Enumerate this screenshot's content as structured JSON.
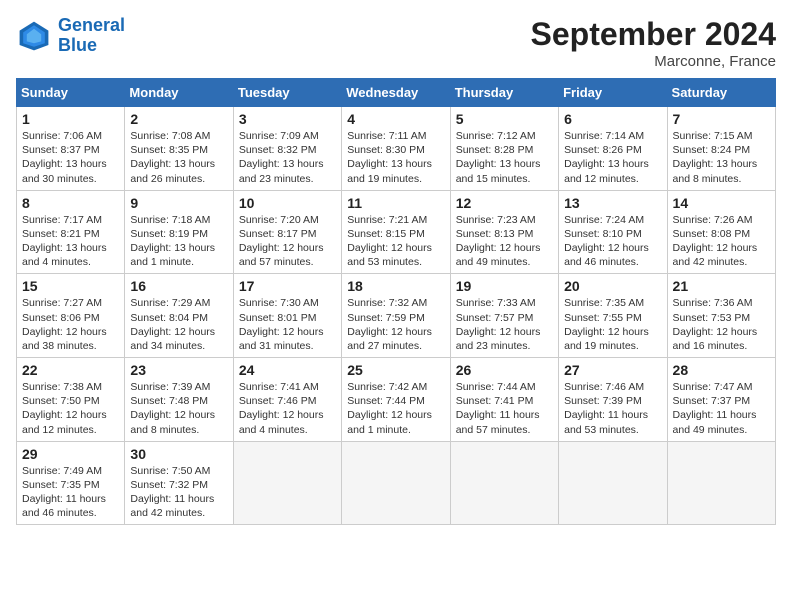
{
  "header": {
    "logo_line1": "General",
    "logo_line2": "Blue",
    "month_title": "September 2024",
    "location": "Marconne, France"
  },
  "days_of_week": [
    "Sunday",
    "Monday",
    "Tuesday",
    "Wednesday",
    "Thursday",
    "Friday",
    "Saturday"
  ],
  "weeks": [
    [
      {
        "day": "1",
        "info": "Sunrise: 7:06 AM\nSunset: 8:37 PM\nDaylight: 13 hours\nand 30 minutes."
      },
      {
        "day": "2",
        "info": "Sunrise: 7:08 AM\nSunset: 8:35 PM\nDaylight: 13 hours\nand 26 minutes."
      },
      {
        "day": "3",
        "info": "Sunrise: 7:09 AM\nSunset: 8:32 PM\nDaylight: 13 hours\nand 23 minutes."
      },
      {
        "day": "4",
        "info": "Sunrise: 7:11 AM\nSunset: 8:30 PM\nDaylight: 13 hours\nand 19 minutes."
      },
      {
        "day": "5",
        "info": "Sunrise: 7:12 AM\nSunset: 8:28 PM\nDaylight: 13 hours\nand 15 minutes."
      },
      {
        "day": "6",
        "info": "Sunrise: 7:14 AM\nSunset: 8:26 PM\nDaylight: 13 hours\nand 12 minutes."
      },
      {
        "day": "7",
        "info": "Sunrise: 7:15 AM\nSunset: 8:24 PM\nDaylight: 13 hours\nand 8 minutes."
      }
    ],
    [
      {
        "day": "8",
        "info": "Sunrise: 7:17 AM\nSunset: 8:21 PM\nDaylight: 13 hours\nand 4 minutes."
      },
      {
        "day": "9",
        "info": "Sunrise: 7:18 AM\nSunset: 8:19 PM\nDaylight: 13 hours\nand 1 minute."
      },
      {
        "day": "10",
        "info": "Sunrise: 7:20 AM\nSunset: 8:17 PM\nDaylight: 12 hours\nand 57 minutes."
      },
      {
        "day": "11",
        "info": "Sunrise: 7:21 AM\nSunset: 8:15 PM\nDaylight: 12 hours\nand 53 minutes."
      },
      {
        "day": "12",
        "info": "Sunrise: 7:23 AM\nSunset: 8:13 PM\nDaylight: 12 hours\nand 49 minutes."
      },
      {
        "day": "13",
        "info": "Sunrise: 7:24 AM\nSunset: 8:10 PM\nDaylight: 12 hours\nand 46 minutes."
      },
      {
        "day": "14",
        "info": "Sunrise: 7:26 AM\nSunset: 8:08 PM\nDaylight: 12 hours\nand 42 minutes."
      }
    ],
    [
      {
        "day": "15",
        "info": "Sunrise: 7:27 AM\nSunset: 8:06 PM\nDaylight: 12 hours\nand 38 minutes."
      },
      {
        "day": "16",
        "info": "Sunrise: 7:29 AM\nSunset: 8:04 PM\nDaylight: 12 hours\nand 34 minutes."
      },
      {
        "day": "17",
        "info": "Sunrise: 7:30 AM\nSunset: 8:01 PM\nDaylight: 12 hours\nand 31 minutes."
      },
      {
        "day": "18",
        "info": "Sunrise: 7:32 AM\nSunset: 7:59 PM\nDaylight: 12 hours\nand 27 minutes."
      },
      {
        "day": "19",
        "info": "Sunrise: 7:33 AM\nSunset: 7:57 PM\nDaylight: 12 hours\nand 23 minutes."
      },
      {
        "day": "20",
        "info": "Sunrise: 7:35 AM\nSunset: 7:55 PM\nDaylight: 12 hours\nand 19 minutes."
      },
      {
        "day": "21",
        "info": "Sunrise: 7:36 AM\nSunset: 7:53 PM\nDaylight: 12 hours\nand 16 minutes."
      }
    ],
    [
      {
        "day": "22",
        "info": "Sunrise: 7:38 AM\nSunset: 7:50 PM\nDaylight: 12 hours\nand 12 minutes."
      },
      {
        "day": "23",
        "info": "Sunrise: 7:39 AM\nSunset: 7:48 PM\nDaylight: 12 hours\nand 8 minutes."
      },
      {
        "day": "24",
        "info": "Sunrise: 7:41 AM\nSunset: 7:46 PM\nDaylight: 12 hours\nand 4 minutes."
      },
      {
        "day": "25",
        "info": "Sunrise: 7:42 AM\nSunset: 7:44 PM\nDaylight: 12 hours\nand 1 minute."
      },
      {
        "day": "26",
        "info": "Sunrise: 7:44 AM\nSunset: 7:41 PM\nDaylight: 11 hours\nand 57 minutes."
      },
      {
        "day": "27",
        "info": "Sunrise: 7:46 AM\nSunset: 7:39 PM\nDaylight: 11 hours\nand 53 minutes."
      },
      {
        "day": "28",
        "info": "Sunrise: 7:47 AM\nSunset: 7:37 PM\nDaylight: 11 hours\nand 49 minutes."
      }
    ],
    [
      {
        "day": "29",
        "info": "Sunrise: 7:49 AM\nSunset: 7:35 PM\nDaylight: 11 hours\nand 46 minutes."
      },
      {
        "day": "30",
        "info": "Sunrise: 7:50 AM\nSunset: 7:32 PM\nDaylight: 11 hours\nand 42 minutes."
      },
      null,
      null,
      null,
      null,
      null
    ]
  ]
}
